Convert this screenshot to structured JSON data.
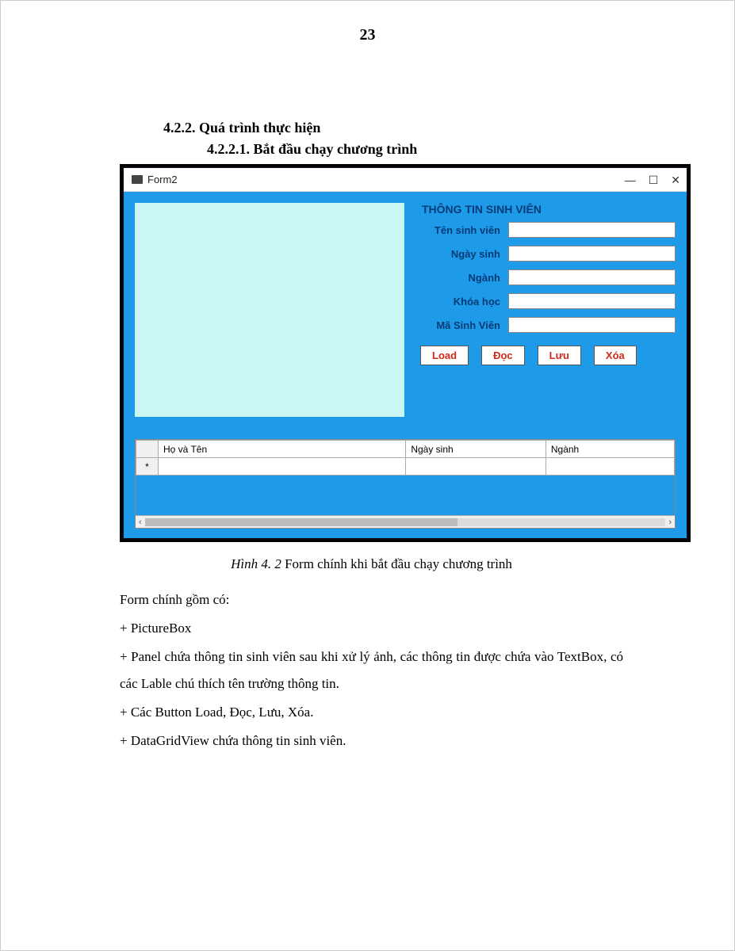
{
  "page_number": "23",
  "heading_422": "4.2.2.  Quá trình thực hiện",
  "heading_4221": "4.2.2.1.   Bắt đầu chạy chương trình",
  "window": {
    "title": "Form2",
    "panel_title": "THÔNG TIN SINH VIÊN",
    "fields": {
      "name_label": "Tên sinh viên",
      "dob_label": "Ngày sinh",
      "major_label": "Ngành",
      "course_label": "Khóa học",
      "id_label": "Mã Sinh Viên"
    },
    "buttons": {
      "load": "Load",
      "read": "Đọc",
      "save": "Lưu",
      "delete": "Xóa"
    },
    "grid": {
      "col_name": "Họ và Tên",
      "col_dob": "Ngày sinh",
      "col_major": "Ngành",
      "row_marker": "*"
    },
    "controls": {
      "minimize": "—",
      "maximize": "☐",
      "close": "✕"
    }
  },
  "caption": {
    "label": "Hình 4. 2",
    "text": " Form chính khi bắt đầu chạy chương trình"
  },
  "body": {
    "p1": "Form chính gồm có:",
    "p2": "+ PictureBox",
    "p3": "+ Panel chứa thông tin sinh viên sau khi xử lý ảnh, các thông tin được chứa vào TextBox, có các Lable chú thích tên trường thông tin.",
    "p4": "+ Các Button Load, Đọc, Lưu, Xóa.",
    "p5": "+ DataGridView chứa thông tin sinh viên."
  }
}
